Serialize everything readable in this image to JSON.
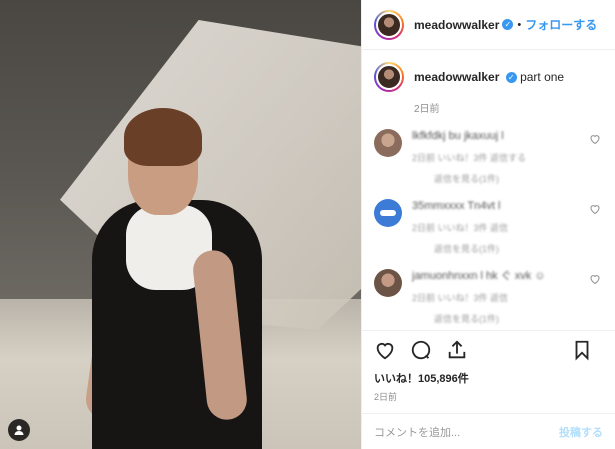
{
  "header": {
    "username": "meadowwalker",
    "separator": "•",
    "follow_label": "フォローする"
  },
  "caption": {
    "username": "meadowwalker",
    "text": "part one",
    "time": "2日前"
  },
  "comments": [
    {
      "avatar_color": "#8b6c5c",
      "text": "lkfkfdkj bu jkaxuuj l",
      "meta": "2日前  いいね！3件  返信する",
      "replies": "返信を見る(1件)"
    },
    {
      "avatar_color": "#3c7bd6",
      "text": "35mmxxxx Tn4vt l",
      "meta": "2日前  いいね！3件  返信",
      "replies": "返信を見る(1件)"
    },
    {
      "avatar_color": "#6b5446",
      "text": "jamuonhnxxn l hk ぐ xvk ☺",
      "meta": "2日前  いいね！3件  返信",
      "replies": "返信を見る(1件)"
    }
  ],
  "likes": {
    "label": "いいね！",
    "count": "105,896件"
  },
  "post_time": "2日前",
  "add_comment": {
    "placeholder": "コメントを追加...",
    "post_label": "投稿する"
  },
  "colors": {
    "accent": "#3897f0",
    "post_disabled": "#b2dffc",
    "border": "#efefef"
  },
  "icons": [
    "heart-icon",
    "comment-icon",
    "share-icon",
    "bookmark-icon",
    "user-tag-icon",
    "verified-badge-icon"
  ]
}
